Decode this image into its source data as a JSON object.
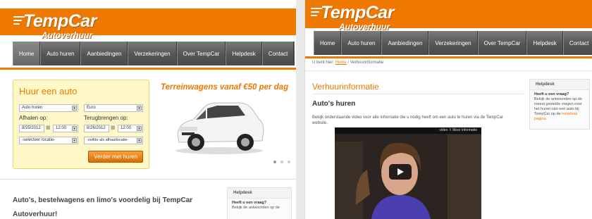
{
  "brand": {
    "name": "TempCar",
    "tagline": "Autoverhuur"
  },
  "nav": [
    "Home",
    "Auto huren",
    "Aanbiedingen",
    "Verzekeringen",
    "Over TempCar",
    "Helpdesk",
    "Contact"
  ],
  "colors": {
    "accent": "#ef7800",
    "nav": "#555555",
    "booking_bg": "#fff9c9"
  },
  "left": {
    "booking": {
      "title": "Huur een auto",
      "type_select": "Auto huren",
      "currency_select": "Euro",
      "pickup_label": "Afhalen op:",
      "return_label": "Terugbrengen op:",
      "pickup_date": "8/25/2012",
      "pickup_time": "12:00",
      "return_date": "8/26/2012",
      "return_time": "12:00",
      "pickup_location": "-selecteer locatie-",
      "return_location": "-zelfde als afhaallocatie-",
      "submit": "Verder met huren"
    },
    "promo": "Terreinwagens vanaf €50 per dag",
    "intro_line1": "Auto's, bestelwagens en limo's voordelig bij TempCar",
    "intro_line2": "Autoverhuur!",
    "helpdesk": {
      "title": "Helpdesk",
      "question": "Heeft u een vraag?",
      "text": "Bekijk de antwoorden op de"
    }
  },
  "right": {
    "breadcrumb_prefix": "U bent hier:",
    "breadcrumb_home": "Home",
    "breadcrumb_current": "/ Verhuurinformatie",
    "title": "Verhuurinformatie",
    "subtitle": "Auto's huren",
    "description": "Bekijk onderstaande video voor alle informatie die u nodig heeft om een auto te huren via de TempCar website.",
    "video_bar": "video  ⇑  Meer informatie",
    "helpdesk": {
      "title": "Helpdesk",
      "question": "Heeft u een vraag?",
      "text": "Bekijk de antwoorden op de meest gestelde vragen over het huren van een auto bij TempCar op de",
      "link": "helpdesk pagina."
    }
  }
}
